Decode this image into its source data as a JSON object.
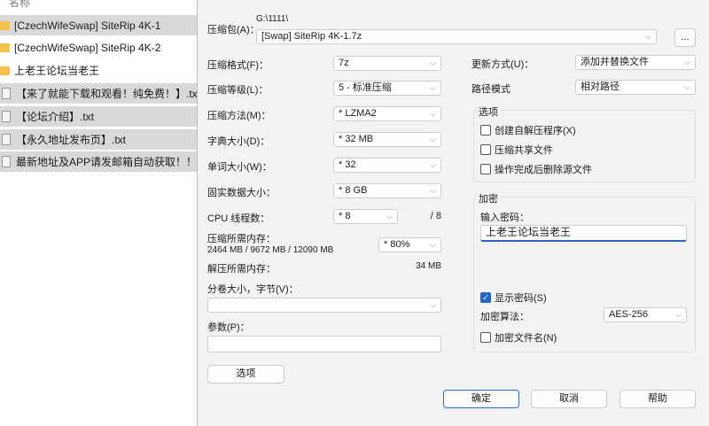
{
  "file_list": {
    "header": "名称",
    "items": [
      {
        "name": "[CzechWifeSwap] SiteRip 4K-1",
        "type": "folder",
        "selected": true
      },
      {
        "name": "[CzechWifeSwap] SiteRip 4K-2",
        "type": "folder",
        "selected": false
      },
      {
        "name": "上老王论坛当老王",
        "type": "folder",
        "selected": false
      },
      {
        "name": "【来了就能下载和观看！纯免费！】.txt",
        "type": "file",
        "selected": true
      },
      {
        "name": "【论坛介绍】.txt",
        "type": "file",
        "selected": true
      },
      {
        "name": "【永久地址发布页】.txt",
        "type": "file",
        "selected": true
      },
      {
        "name": "最新地址及APP请发邮箱自动获取！！！...",
        "type": "file",
        "selected": true
      }
    ]
  },
  "dialog": {
    "archive_label": "压缩包(A)：",
    "archive_path": "G:\\1111\\",
    "archive_name": "[Swap] SiteRip 4K-1.7z",
    "browse_label": "...",
    "format_label": "压缩格式(F)：",
    "format": "7z",
    "level_label": "压缩等级(L)：",
    "level": "5 - 标准压缩",
    "method_label": "压缩方法(M)：",
    "method": "* LZMA2",
    "dict_label": "字典大小(D)：",
    "dict": "* 32 MB",
    "word_label": "单词大小(W)：",
    "word": "* 32",
    "solid_label": "固实数据大小：",
    "solid": "* 8 GB",
    "cpu_label": "CPU 线程数：",
    "cpu": "* 8",
    "cpu_max": "/ 8",
    "mem_label": "压缩所需内存：",
    "mem_values": "2464 MB / 9672 MB / 12090 MB",
    "mem_percent": "* 80%",
    "decomp_label": "解压所需内存：",
    "decomp_value": "34 MB",
    "volume_label": "分卷大小，字节(V)：",
    "volume": "",
    "params_label": "参数(P)：",
    "params": "",
    "options_button": "选项",
    "update_label": "更新方式(U)：",
    "update": "添加并替换文件",
    "path_label": "路径模式",
    "path": "相对路径",
    "options_group": "选项",
    "options": [
      {
        "label": "创建自解压程序(X)",
        "checked": false
      },
      {
        "label": "压缩共享文件",
        "checked": false
      },
      {
        "label": "操作完成后删除源文件",
        "checked": false
      }
    ],
    "encrypt_group": "加密",
    "password_label": "输入密码：",
    "password": "上老王论坛当老王",
    "show_password": {
      "label": "显示密码(S)",
      "checked": true
    },
    "algo_label": "加密算法：",
    "algo": "AES-256",
    "encrypt_names": {
      "label": "加密文件名(N)",
      "checked": false
    },
    "ok": "确定",
    "cancel": "取消",
    "help": "帮助"
  },
  "colors": {
    "accent": "#2467c2",
    "selection": "#d9d9d9",
    "folder": "#f4c24a"
  }
}
